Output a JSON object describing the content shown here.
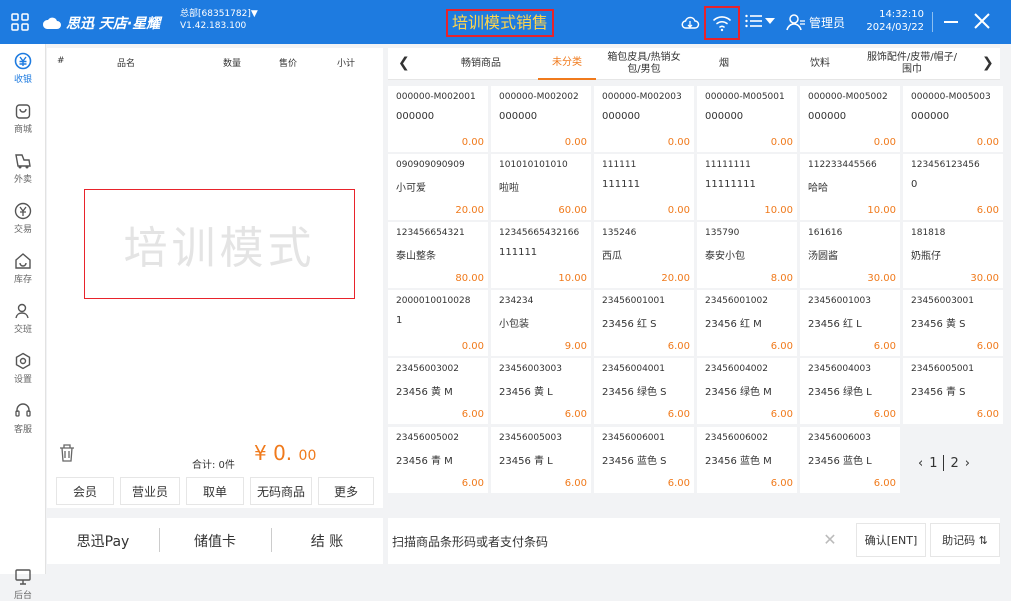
{
  "topbar": {
    "brand": "思迅 天店·星耀",
    "store_line1": "总部[68351782]▼",
    "store_line2": "V1.42.183.100",
    "title": "培训模式销售",
    "user": "管理员",
    "time": "14:32:10",
    "date": "2024/03/22"
  },
  "sidebar": {
    "items": [
      {
        "label": "收银",
        "icon": "cashier-icon"
      },
      {
        "label": "商城",
        "icon": "mall-icon"
      },
      {
        "label": "外卖",
        "icon": "takeout-icon"
      },
      {
        "label": "交易",
        "icon": "trade-icon"
      },
      {
        "label": "库存",
        "icon": "stock-icon"
      },
      {
        "label": "交班",
        "icon": "shift-icon"
      },
      {
        "label": "设置",
        "icon": "settings-icon"
      },
      {
        "label": "客服",
        "icon": "support-icon"
      }
    ],
    "bottom": "后台"
  },
  "cart": {
    "columns": {
      "index": "#",
      "name": "品名",
      "qty": "数量",
      "price": "售价",
      "subtotal": "小计"
    },
    "watermark": "培训模式",
    "total_label": "合计: 0件",
    "total_symbol": "¥ 0.",
    "total_decimal": "00",
    "actions": [
      "会员",
      "营业员",
      "取单",
      "无码商品",
      "更多"
    ]
  },
  "paybar": {
    "items": [
      "思迅Pay",
      "储值卡",
      "结 账"
    ]
  },
  "categories": {
    "tabs": [
      "畅销商品",
      "未分类",
      "箱包皮具/热销女包/男包",
      "烟",
      "饮料",
      "服饰配件/皮带/帽子/围巾"
    ],
    "active": 1
  },
  "products": [
    {
      "code": "000000-M002001",
      "name": "000000",
      "price": "0.00"
    },
    {
      "code": "000000-M002002",
      "name": "000000",
      "price": "0.00"
    },
    {
      "code": "000000-M002003",
      "name": "000000",
      "price": "0.00"
    },
    {
      "code": "000000-M005001",
      "name": "000000",
      "price": "0.00"
    },
    {
      "code": "000000-M005002",
      "name": "000000",
      "price": "0.00"
    },
    {
      "code": "000000-M005003",
      "name": "000000",
      "price": "0.00"
    },
    {
      "code": "090909090909",
      "name": "小可爱",
      "price": "20.00"
    },
    {
      "code": "101010101010",
      "name": "啦啦",
      "price": "60.00"
    },
    {
      "code": "111111",
      "name": "111111",
      "price": "0.00"
    },
    {
      "code": "11111111",
      "name": "11111111",
      "price": "10.00"
    },
    {
      "code": "112233445566",
      "name": "哈哈",
      "price": "10.00"
    },
    {
      "code": "123456123456",
      "name": "0",
      "price": "6.00"
    },
    {
      "code": "123456654321",
      "name": "泰山整条",
      "price": "80.00"
    },
    {
      "code": "12345665432166",
      "name": "111111",
      "price": "10.00"
    },
    {
      "code": "135246",
      "name": "西瓜",
      "price": "20.00"
    },
    {
      "code": "135790",
      "name": "泰安小包",
      "price": "8.00"
    },
    {
      "code": "161616",
      "name": "汤圆酱",
      "price": "30.00"
    },
    {
      "code": "181818",
      "name": "奶瓶仔",
      "price": "30.00"
    },
    {
      "code": "2000010010028",
      "name": "1",
      "price": "0.00"
    },
    {
      "code": "234234",
      "name": "小包装",
      "price": "9.00"
    },
    {
      "code": "23456001001",
      "name": "23456 红 S",
      "price": "6.00"
    },
    {
      "code": "23456001002",
      "name": "23456 红 M",
      "price": "6.00"
    },
    {
      "code": "23456001003",
      "name": "23456 红 L",
      "price": "6.00"
    },
    {
      "code": "23456003001",
      "name": "23456 黄 S",
      "price": "6.00"
    },
    {
      "code": "23456003002",
      "name": "23456 黄 M",
      "price": "6.00"
    },
    {
      "code": "23456003003",
      "name": "23456 黄 L",
      "price": "6.00"
    },
    {
      "code": "23456004001",
      "name": "23456 绿色 S",
      "price": "6.00"
    },
    {
      "code": "23456004002",
      "name": "23456 绿色 M",
      "price": "6.00"
    },
    {
      "code": "23456004003",
      "name": "23456 绿色 L",
      "price": "6.00"
    },
    {
      "code": "23456005001",
      "name": "23456 青 S",
      "price": "6.00"
    },
    {
      "code": "23456005002",
      "name": "23456 青 M",
      "price": "6.00"
    },
    {
      "code": "23456005003",
      "name": "23456 青 L",
      "price": "6.00"
    },
    {
      "code": "23456006001",
      "name": "23456 蓝色 S",
      "price": "6.00"
    },
    {
      "code": "23456006002",
      "name": "23456 蓝色 M",
      "price": "6.00"
    },
    {
      "code": "23456006003",
      "name": "23456 蓝色 L",
      "price": "6.00"
    }
  ],
  "pager": {
    "current": "1",
    "next": "2"
  },
  "scan": {
    "placeholder": "扫描商品条形码或者支付条码",
    "confirm": "确认[ENT]",
    "memo": "助记码 ⇅"
  },
  "colors": {
    "primary": "#1e7be0",
    "accent": "#f07a1c",
    "highlight": "#e8232b",
    "title": "#ffd54a"
  }
}
